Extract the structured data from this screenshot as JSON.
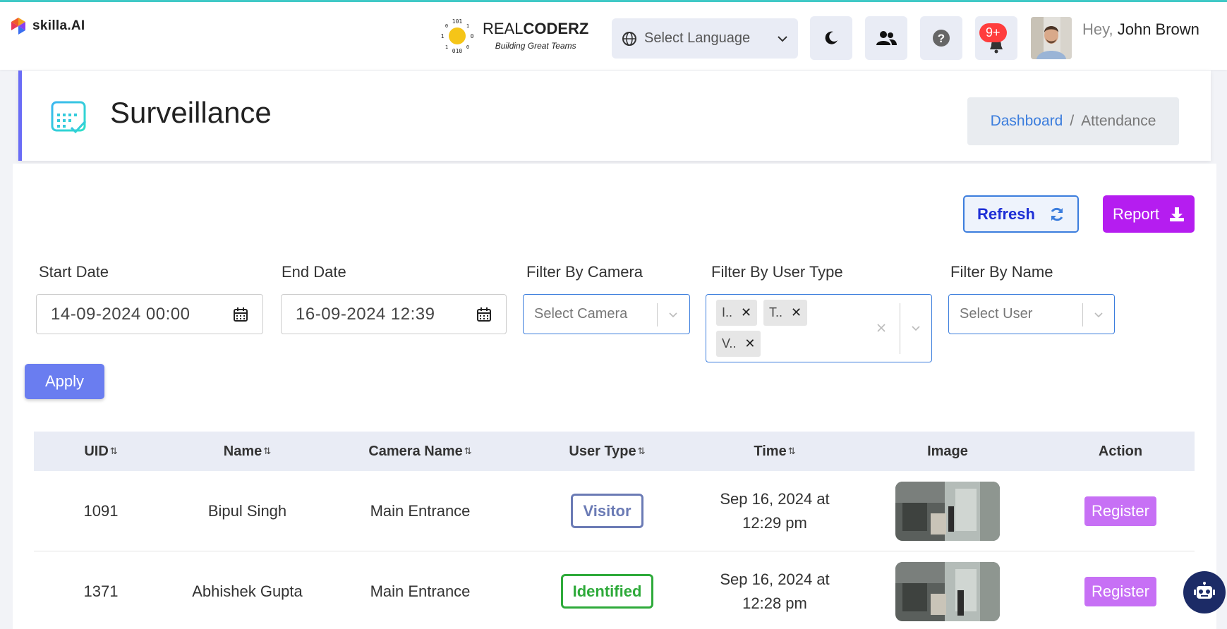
{
  "app": {
    "logo_text": "skilla.AI"
  },
  "brand": {
    "name_light": "REAL",
    "name_bold": "CODERZ",
    "tagline": "Building Great Teams"
  },
  "topbar": {
    "language_placeholder": "Select Language",
    "notification_badge": "9+",
    "greeting_prefix": "Hey,",
    "user_name": "John Brown"
  },
  "header": {
    "title": "Surveillance",
    "breadcrumb": {
      "link": "Dashboard",
      "separator": "/",
      "current": "Attendance"
    }
  },
  "actions": {
    "refresh_label": "Refresh",
    "report_label": "Report"
  },
  "filters": {
    "start_date": {
      "label": "Start Date",
      "value": "14-09-2024 00:00"
    },
    "end_date": {
      "label": "End Date",
      "value": "16-09-2024 12:39"
    },
    "camera": {
      "label": "Filter By Camera",
      "placeholder": "Select Camera"
    },
    "user_type": {
      "label": "Filter By User Type",
      "chips": [
        "I..",
        "T..",
        "V.."
      ]
    },
    "name": {
      "label": "Filter By Name",
      "placeholder": "Select User"
    },
    "apply_label": "Apply"
  },
  "table": {
    "columns": [
      "UID",
      "Name",
      "Camera Name",
      "User Type",
      "Time",
      "Image",
      "Action"
    ],
    "sort_glyph": "⇅",
    "rows": [
      {
        "uid": "1091",
        "name": "Bipul Singh",
        "camera": "Main Entrance",
        "user_type": "Visitor",
        "time_line1": "Sep 16, 2024 at",
        "time_line2": "12:29 pm",
        "action": "Register"
      },
      {
        "uid": "1371",
        "name": "Abhishek Gupta",
        "camera": "Main Entrance",
        "user_type": "Identified",
        "time_line1": "Sep 16, 2024 at",
        "time_line2": "12:28 pm",
        "action": "Register"
      }
    ]
  },
  "colors": {
    "accent": "#6a6cf6",
    "report": "#b51df0",
    "register": "#c770f5",
    "visitor": "#6b7bb5",
    "identified": "#2eaa3a",
    "teal_border": "#40c9c6"
  }
}
